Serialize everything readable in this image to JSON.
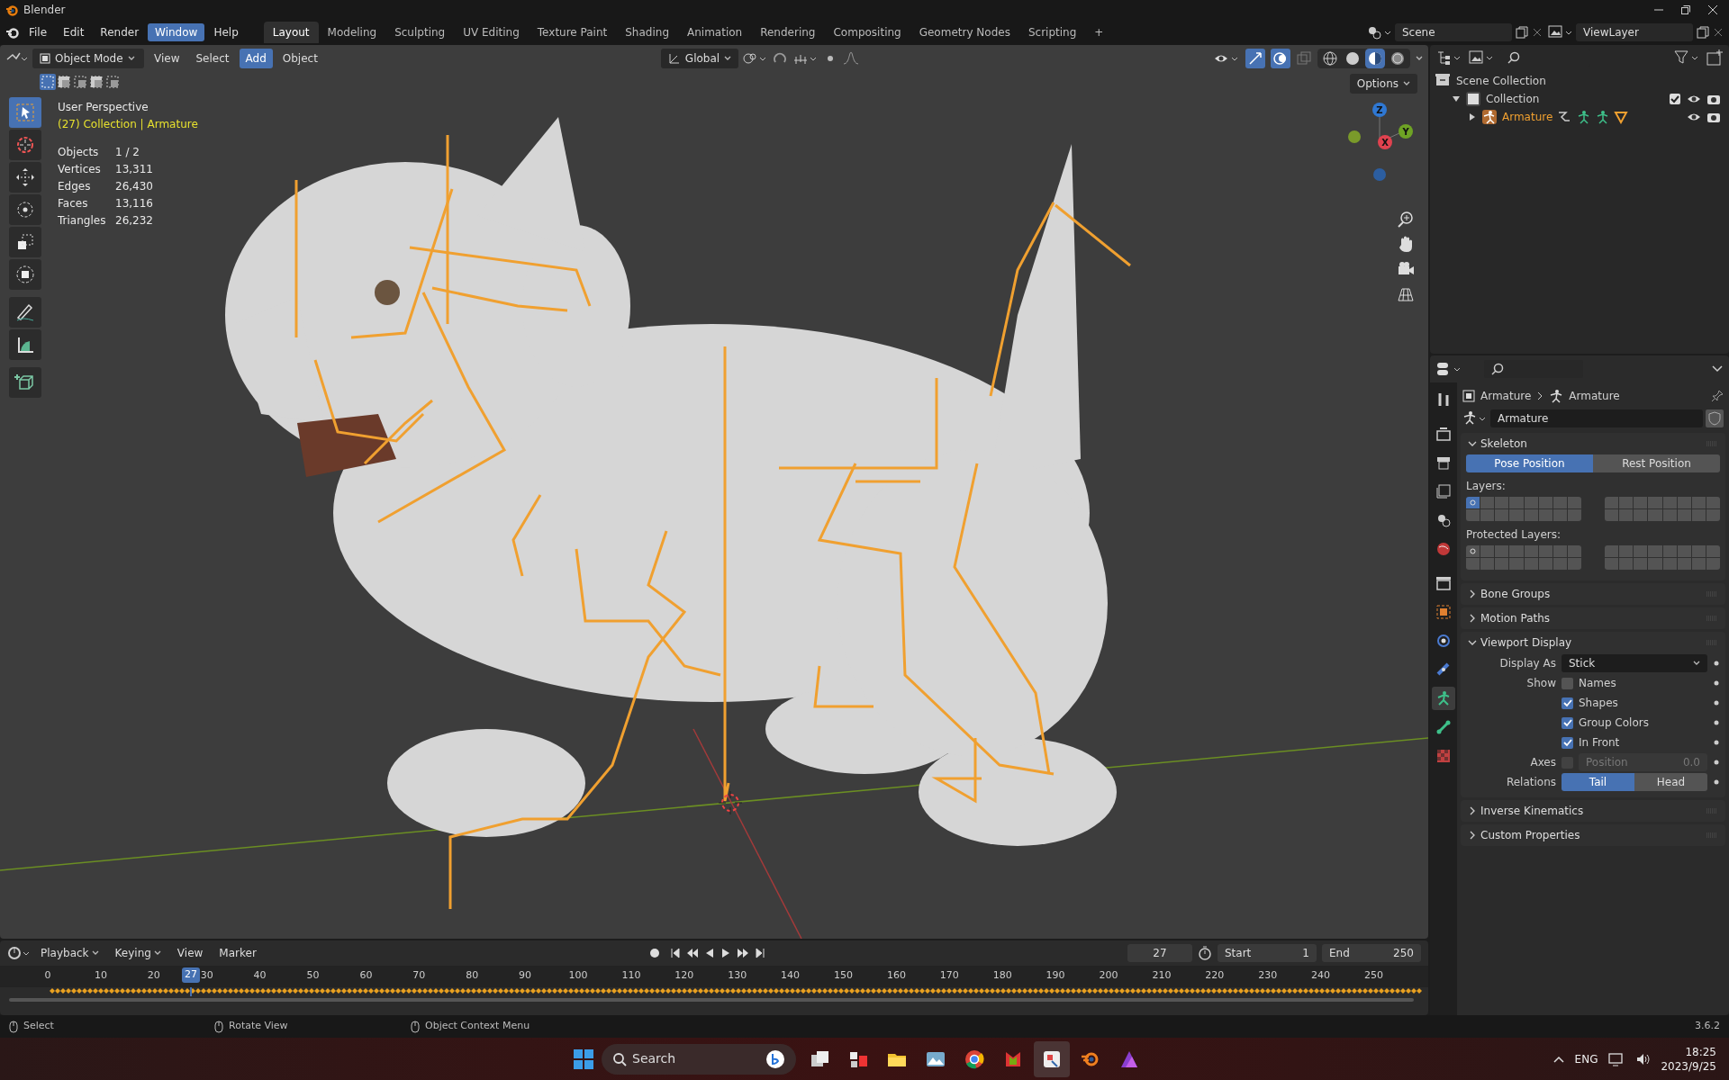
{
  "window": {
    "title": "Blender"
  },
  "menu": [
    {
      "label": "File",
      "selected": false
    },
    {
      "label": "Edit",
      "selected": false
    },
    {
      "label": "Render",
      "selected": false
    },
    {
      "label": "Window",
      "selected": true
    },
    {
      "label": "Help",
      "selected": false
    }
  ],
  "workspaces": [
    {
      "label": "Layout",
      "selected": true
    },
    {
      "label": "Modeling",
      "selected": false
    },
    {
      "label": "Sculpting",
      "selected": false
    },
    {
      "label": "UV Editing",
      "selected": false
    },
    {
      "label": "Texture Paint",
      "selected": false
    },
    {
      "label": "Shading",
      "selected": false
    },
    {
      "label": "Animation",
      "selected": false
    },
    {
      "label": "Rendering",
      "selected": false
    },
    {
      "label": "Compositing",
      "selected": false
    },
    {
      "label": "Geometry Nodes",
      "selected": false
    },
    {
      "label": "Scripting",
      "selected": false
    }
  ],
  "add_workspace": "+",
  "scene": {
    "value": "Scene"
  },
  "view_layer": {
    "value": "ViewLayer"
  },
  "viewport_header": {
    "mode": "Object Mode",
    "menus": [
      {
        "label": "View",
        "selected": false
      },
      {
        "label": "Select",
        "selected": false
      },
      {
        "label": "Add",
        "selected": true
      },
      {
        "label": "Object",
        "selected": false
      }
    ],
    "orientation": "Global",
    "options": "Options",
    "shading": [
      {
        "kind": "wireframe",
        "selected": false
      },
      {
        "kind": "solid",
        "selected": false
      },
      {
        "kind": "material",
        "selected": true
      },
      {
        "kind": "rendered",
        "selected": false
      }
    ]
  },
  "tools": [
    {
      "kind": "select",
      "selected": true
    },
    {
      "kind": "cursor",
      "selected": false
    },
    {
      "kind": "move",
      "selected": false
    },
    {
      "kind": "rotate",
      "selected": false
    },
    {
      "kind": "scale",
      "selected": false
    },
    {
      "kind": "transform",
      "selected": false
    },
    {
      "kind": "annotate",
      "selected": false
    },
    {
      "kind": "measure",
      "selected": false
    },
    {
      "kind": "add_cube",
      "selected": false
    }
  ],
  "viewport": {
    "view_name": "User Perspective",
    "context": "(27) Collection | Armature",
    "stats": [
      {
        "label": "Objects",
        "value": "1 / 2"
      },
      {
        "label": "Vertices",
        "value": "13,311"
      },
      {
        "label": "Edges",
        "value": "26,430"
      },
      {
        "label": "Faces",
        "value": "13,116"
      },
      {
        "label": "Triangles",
        "value": "26,232"
      }
    ],
    "gizmo_axes": [
      {
        "label": "Z",
        "color": "#2f78d3"
      },
      {
        "label": "Y",
        "color": "#6ea325"
      },
      {
        "label": "X",
        "color": "#e0424f"
      }
    ]
  },
  "outliner": {
    "items": [
      {
        "label": "Scene Collection",
        "kind": "scene",
        "children": [
          {
            "label": "Collection",
            "kind": "collection",
            "expanded": true,
            "included": true,
            "children": [
              {
                "label": "Armature",
                "kind": "armature",
                "expanded": false
              }
            ]
          }
        ]
      }
    ]
  },
  "properties": {
    "breadcrumb": [
      "Armature",
      "Armature"
    ],
    "data_name": "Armature",
    "tabs": [
      {
        "kind": "tool",
        "selected": false
      },
      {
        "kind": "render",
        "selected": false
      },
      {
        "kind": "output",
        "selected": false
      },
      {
        "kind": "view_layer",
        "selected": false
      },
      {
        "kind": "scene",
        "selected": false
      },
      {
        "kind": "world",
        "selected": false
      },
      {
        "kind": "collection",
        "selected": false
      },
      {
        "kind": "object",
        "selected": false
      },
      {
        "kind": "physics",
        "selected": false
      },
      {
        "kind": "constraints",
        "selected": false
      },
      {
        "kind": "armature",
        "selected": true
      },
      {
        "kind": "bone",
        "selected": false
      },
      {
        "kind": "texture",
        "selected": false
      }
    ],
    "panels": [
      {
        "title": "Skeleton",
        "expanded": true,
        "kind": "skeleton",
        "positions": [
          {
            "label": "Pose Position",
            "selected": true
          },
          {
            "label": "Rest Position",
            "selected": false
          }
        ],
        "layer_groups": [
          {
            "label": "Layers:",
            "cells": [
              {
                "on": true,
                "used": true
              },
              {
                "on": false,
                "used": false
              },
              {
                "on": false,
                "used": false
              },
              {
                "on": false,
                "used": false
              },
              {
                "on": false,
                "used": false
              },
              {
                "on": false,
                "used": false
              },
              {
                "on": false,
                "used": false
              },
              {
                "on": false,
                "used": false
              },
              {
                "on": false,
                "used": false
              },
              {
                "on": false,
                "used": false
              },
              {
                "on": false,
                "used": false
              },
              {
                "on": false,
                "used": false
              },
              {
                "on": false,
                "used": false
              },
              {
                "on": false,
                "used": false
              },
              {
                "on": false,
                "used": false
              },
              {
                "on": false,
                "used": false
              },
              {
                "on": false,
                "used": false
              },
              {
                "on": false,
                "used": false
              },
              {
                "on": false,
                "used": false
              },
              {
                "on": false,
                "used": false
              },
              {
                "on": false,
                "used": false
              },
              {
                "on": false,
                "used": false
              },
              {
                "on": false,
                "used": false
              },
              {
                "on": false,
                "used": false
              },
              {
                "on": false,
                "used": false
              },
              {
                "on": false,
                "used": false
              },
              {
                "on": false,
                "used": false
              },
              {
                "on": false,
                "used": false
              },
              {
                "on": false,
                "used": false
              },
              {
                "on": false,
                "used": false
              },
              {
                "on": false,
                "used": false
              },
              {
                "on": false,
                "used": false
              }
            ]
          },
          {
            "label": "Protected Layers:",
            "cells": [
              {
                "on": false,
                "used": true
              },
              {
                "on": false,
                "used": false
              },
              {
                "on": false,
                "used": false
              },
              {
                "on": false,
                "used": false
              },
              {
                "on": false,
                "used": false
              },
              {
                "on": false,
                "used": false
              },
              {
                "on": false,
                "used": false
              },
              {
                "on": false,
                "used": false
              },
              {
                "on": false,
                "used": false
              },
              {
                "on": false,
                "used": false
              },
              {
                "on": false,
                "used": false
              },
              {
                "on": false,
                "used": false
              },
              {
                "on": false,
                "used": false
              },
              {
                "on": false,
                "used": false
              },
              {
                "on": false,
                "used": false
              },
              {
                "on": false,
                "used": false
              },
              {
                "on": false,
                "used": false
              },
              {
                "on": false,
                "used": false
              },
              {
                "on": false,
                "used": false
              },
              {
                "on": false,
                "used": false
              },
              {
                "on": false,
                "used": false
              },
              {
                "on": false,
                "used": false
              },
              {
                "on": false,
                "used": false
              },
              {
                "on": false,
                "used": false
              },
              {
                "on": false,
                "used": false
              },
              {
                "on": false,
                "used": false
              },
              {
                "on": false,
                "used": false
              },
              {
                "on": false,
                "used": false
              },
              {
                "on": false,
                "used": false
              },
              {
                "on": false,
                "used": false
              },
              {
                "on": false,
                "used": false
              },
              {
                "on": false,
                "used": false
              }
            ]
          }
        ]
      },
      {
        "title": "Bone Groups",
        "expanded": false
      },
      {
        "title": "Motion Paths",
        "expanded": false
      },
      {
        "title": "Viewport Display",
        "expanded": true,
        "kind": "viewport_display",
        "display_as": {
          "label": "Display As",
          "value": "Stick"
        },
        "show": {
          "label": "Show",
          "options": [
            {
              "label": "Names",
              "checked": false
            },
            {
              "label": "Shapes",
              "checked": true
            },
            {
              "label": "Group Colors",
              "checked": true
            },
            {
              "label": "In Front",
              "checked": true
            }
          ]
        },
        "axes": {
          "label": "Axes",
          "checked": false,
          "disabled": true,
          "field": "Position",
          "value": "0.0"
        },
        "relations": {
          "label": "Relations",
          "options": [
            {
              "label": "Tail",
              "selected": true
            },
            {
              "label": "Head",
              "selected": false
            }
          ]
        }
      },
      {
        "title": "Inverse Kinematics",
        "expanded": false
      },
      {
        "title": "Custom Properties",
        "expanded": false
      }
    ]
  },
  "timeline": {
    "menus": [
      "Playback",
      "Keying",
      "View",
      "Marker"
    ],
    "current_frame": "27",
    "start_label": "Start",
    "start": "1",
    "end_label": "End",
    "end": "250",
    "ticks": [
      "0",
      "10",
      "20",
      "30",
      "40",
      "50",
      "60",
      "70",
      "80",
      "90",
      "100",
      "110",
      "120",
      "130",
      "140",
      "150",
      "160",
      "170",
      "180",
      "190",
      "200",
      "210",
      "220",
      "230",
      "240",
      "250"
    ],
    "playhead": {
      "label": "27",
      "level": 0.108
    }
  },
  "status_bar": {
    "hints": [
      "Select",
      "Rotate View",
      "Object Context Menu"
    ],
    "version": "3.6.2"
  },
  "taskbar": {
    "search": "Search",
    "apps": [
      {
        "kind": "taskview",
        "selected": false
      },
      {
        "kind": "widgets",
        "selected": false
      },
      {
        "kind": "folder",
        "selected": false
      },
      {
        "kind": "photos",
        "selected": false
      },
      {
        "kind": "chrome",
        "selected": false
      },
      {
        "kind": "m_logo",
        "selected": false
      },
      {
        "kind": "snip",
        "selected": true
      },
      {
        "kind": "blender",
        "selected": false
      },
      {
        "kind": "affinity",
        "selected": false
      }
    ],
    "language": "ENG",
    "time": "18:25",
    "date": "2023/9/25"
  }
}
